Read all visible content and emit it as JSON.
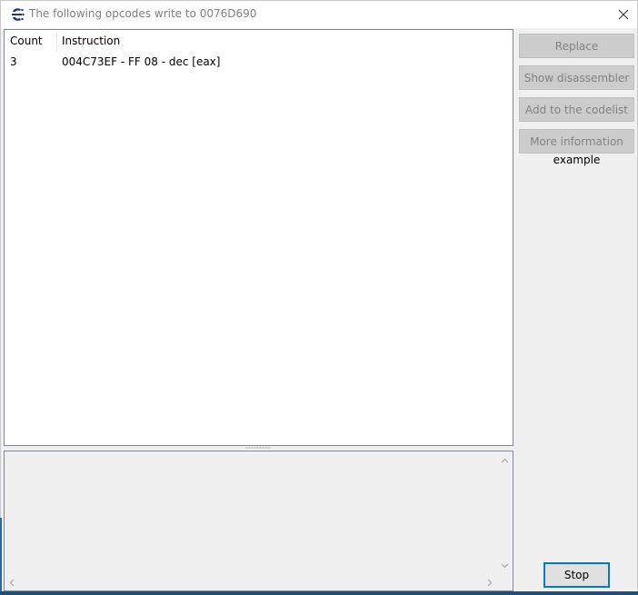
{
  "window": {
    "title": "The following opcodes write to 0076D690"
  },
  "listview": {
    "columns": [
      "Count",
      "Instruction"
    ],
    "rows": [
      {
        "count": "3",
        "instruction": "004C73EF - FF 08  - dec [eax]"
      }
    ]
  },
  "side_panel": {
    "replace_label": "Replace",
    "show_disassembler_label": "Show disassembler",
    "add_to_codelist_label": "Add to the codelist",
    "more_information_label": "More information",
    "example_text": "example",
    "stop_label": "Stop"
  },
  "icons": {
    "app": "cheat-engine-icon",
    "close": "close-icon",
    "scroll_up": "chevron-up-icon",
    "scroll_down": "chevron-down-icon",
    "scroll_left": "chevron-left-icon",
    "scroll_right": "chevron-right-icon"
  },
  "colors": {
    "accent": "#0078d7",
    "disabled_button_bg": "#cccccc",
    "disabled_text": "#838383"
  }
}
